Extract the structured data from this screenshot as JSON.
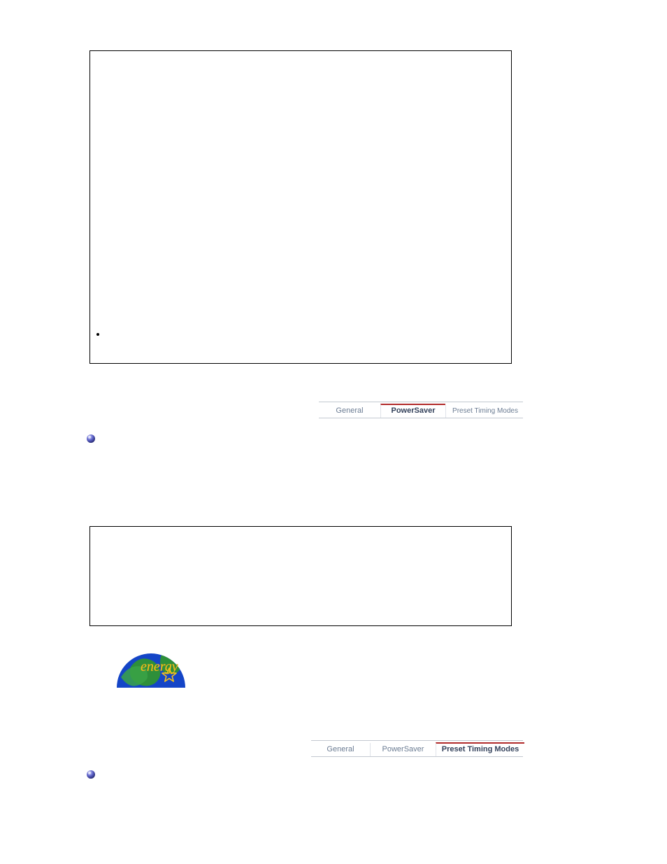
{
  "tabs_section1": {
    "items": [
      {
        "label": "General"
      },
      {
        "label": "PowerSaver"
      },
      {
        "label": "Preset Timing Modes"
      }
    ],
    "active_index": 1
  },
  "tabs_section2": {
    "items": [
      {
        "label": "General"
      },
      {
        "label": "PowerSaver"
      },
      {
        "label": "Preset Timing Modes"
      }
    ],
    "active_index": 2
  }
}
